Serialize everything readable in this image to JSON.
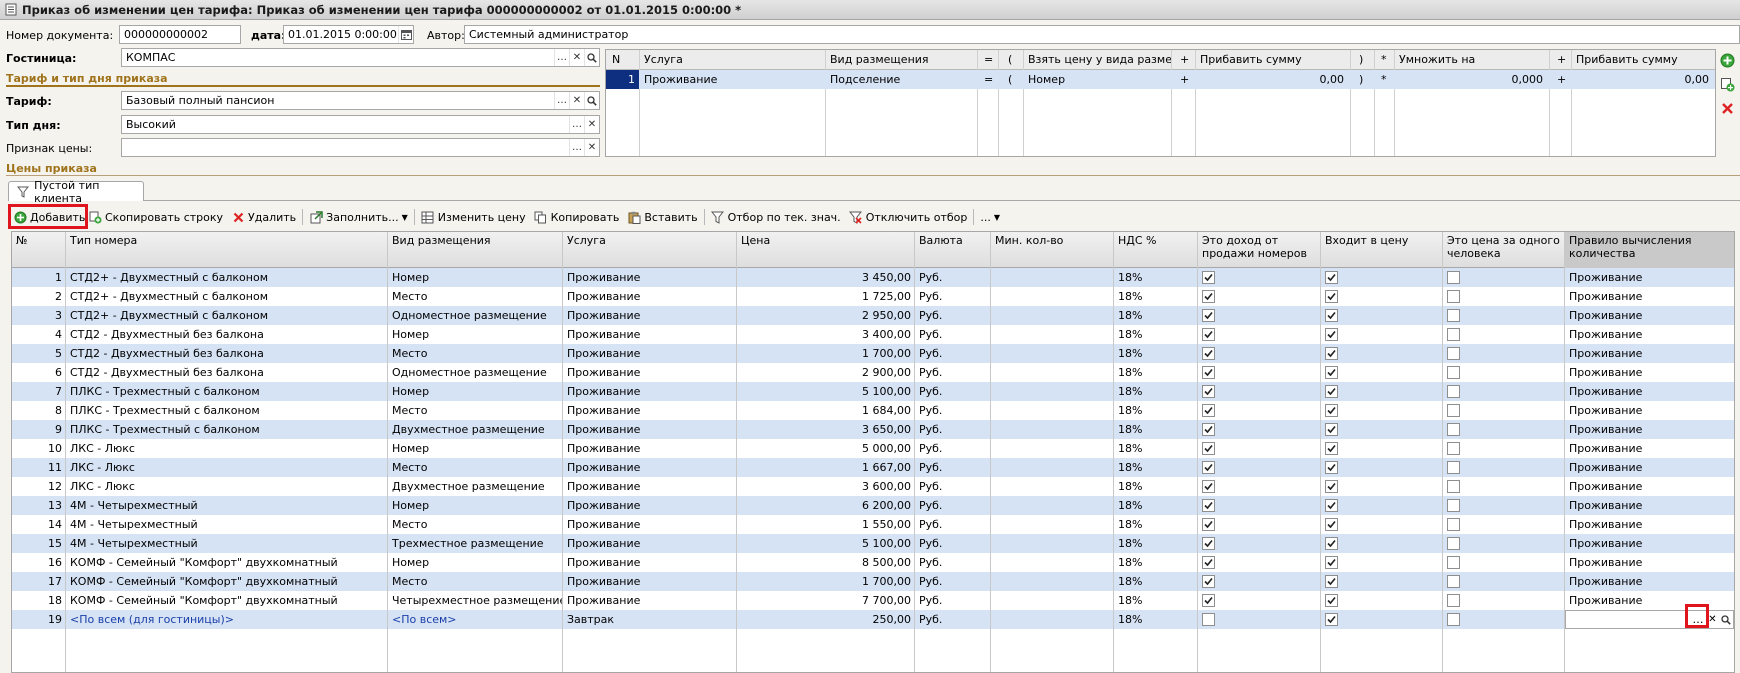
{
  "window": {
    "title": "Приказ об изменении цен тарифа: Приказ об изменении цен тарифа 000000000002 от 01.01.2015 0:00:00 *"
  },
  "header": {
    "doc_number_label": "Номер документа:",
    "doc_number": "000000000002",
    "date_label": "дата:",
    "date": "01.01.2015  0:00:00",
    "author_label": "Автор:",
    "author": "Системный администратор",
    "hotel_label": "Гостиница:",
    "hotel": "КОМПАС",
    "section_tariff": "Тариф и тип дня приказа",
    "tariff_label": "Тариф:",
    "tariff": "Базовый полный пансион",
    "daytype_label": "Тип дня:",
    "daytype": "Высокий",
    "price_sign_label": "Признак цены:",
    "price_sign": "",
    "section_prices": "Цены приказа"
  },
  "services_table": {
    "headers": [
      "N",
      "Услуга",
      "Вид размещения",
      "=",
      "(",
      "Взять цену у вида размещ.",
      "+",
      "Прибавить сумму",
      ")",
      "*",
      "Умножить на",
      "+",
      "Прибавить сумму"
    ],
    "rows": [
      [
        "1",
        "Проживание",
        "Подселение",
        "=",
        "(",
        "Номер",
        "+",
        "0,00",
        ")",
        "*",
        "0,000",
        "+",
        "0,00"
      ]
    ]
  },
  "tab": {
    "label": "Пустой тип клиента"
  },
  "toolbar": {
    "add": "Добавить",
    "copy_row": "Скопировать строку",
    "delete": "Удалить",
    "fill": "Заполнить...",
    "change_price": "Изменить цену",
    "copy": "Копировать",
    "paste": "Вставить",
    "filter": "Отбор по тек. знач.",
    "disable_filter": "Отключить отбор",
    "more": "..."
  },
  "grid": {
    "headers": [
      "№",
      "Тип номера",
      "Вид размещения",
      "Услуга",
      "Цена",
      "Валюта",
      "Мин. кол-во",
      "НДС %",
      "Это доход от продажи номеров",
      "Входит в цену",
      "Это цена за одного человека",
      "Правило вычисления количества"
    ],
    "rows": [
      {
        "n": "1",
        "type": "СТД2+ - Двухместный с балконом",
        "acc": "Номер",
        "svc": "Проживание",
        "price": "3 450,00",
        "cur": "Руб.",
        "min": "",
        "vat": "18%",
        "income": true,
        "incl": true,
        "perperson": false,
        "rule": "Проживание"
      },
      {
        "n": "2",
        "type": "СТД2+ - Двухместный с балконом",
        "acc": "Место",
        "svc": "Проживание",
        "price": "1 725,00",
        "cur": "Руб.",
        "min": "",
        "vat": "18%",
        "income": true,
        "incl": true,
        "perperson": false,
        "rule": "Проживание"
      },
      {
        "n": "3",
        "type": "СТД2+ - Двухместный с балконом",
        "acc": "Одноместное размещение",
        "svc": "Проживание",
        "price": "2 950,00",
        "cur": "Руб.",
        "min": "",
        "vat": "18%",
        "income": true,
        "incl": true,
        "perperson": false,
        "rule": "Проживание"
      },
      {
        "n": "4",
        "type": "СТД2 - Двухместный без балкона",
        "acc": "Номер",
        "svc": "Проживание",
        "price": "3 400,00",
        "cur": "Руб.",
        "min": "",
        "vat": "18%",
        "income": true,
        "incl": true,
        "perperson": false,
        "rule": "Проживание"
      },
      {
        "n": "5",
        "type": "СТД2 - Двухместный без балкона",
        "acc": "Место",
        "svc": "Проживание",
        "price": "1 700,00",
        "cur": "Руб.",
        "min": "",
        "vat": "18%",
        "income": true,
        "incl": true,
        "perperson": false,
        "rule": "Проживание"
      },
      {
        "n": "6",
        "type": "СТД2 - Двухместный без балкона",
        "acc": "Одноместное размещение",
        "svc": "Проживание",
        "price": "2 900,00",
        "cur": "Руб.",
        "min": "",
        "vat": "18%",
        "income": true,
        "incl": true,
        "perperson": false,
        "rule": "Проживание"
      },
      {
        "n": "7",
        "type": "ПЛКС - Трехместный с балконом",
        "acc": "Номер",
        "svc": "Проживание",
        "price": "5 100,00",
        "cur": "Руб.",
        "min": "",
        "vat": "18%",
        "income": true,
        "incl": true,
        "perperson": false,
        "rule": "Проживание"
      },
      {
        "n": "8",
        "type": "ПЛКС - Трехместный с балконом",
        "acc": "Место",
        "svc": "Проживание",
        "price": "1 684,00",
        "cur": "Руб.",
        "min": "",
        "vat": "18%",
        "income": true,
        "incl": true,
        "perperson": false,
        "rule": "Проживание"
      },
      {
        "n": "9",
        "type": "ПЛКС - Трехместный с балконом",
        "acc": "Двухместное размещение",
        "svc": "Проживание",
        "price": "3 650,00",
        "cur": "Руб.",
        "min": "",
        "vat": "18%",
        "income": true,
        "incl": true,
        "perperson": false,
        "rule": "Проживание"
      },
      {
        "n": "10",
        "type": "ЛКС - Люкс",
        "acc": "Номер",
        "svc": "Проживание",
        "price": "5 000,00",
        "cur": "Руб.",
        "min": "",
        "vat": "18%",
        "income": true,
        "incl": true,
        "perperson": false,
        "rule": "Проживание"
      },
      {
        "n": "11",
        "type": "ЛКС - Люкс",
        "acc": "Место",
        "svc": "Проживание",
        "price": "1 667,00",
        "cur": "Руб.",
        "min": "",
        "vat": "18%",
        "income": true,
        "incl": true,
        "perperson": false,
        "rule": "Проживание"
      },
      {
        "n": "12",
        "type": "ЛКС - Люкс",
        "acc": "Двухместное размещение",
        "svc": "Проживание",
        "price": "3 600,00",
        "cur": "Руб.",
        "min": "",
        "vat": "18%",
        "income": true,
        "incl": true,
        "perperson": false,
        "rule": "Проживание"
      },
      {
        "n": "13",
        "type": "4М - Четырехместный",
        "acc": "Номер",
        "svc": "Проживание",
        "price": "6 200,00",
        "cur": "Руб.",
        "min": "",
        "vat": "18%",
        "income": true,
        "incl": true,
        "perperson": false,
        "rule": "Проживание"
      },
      {
        "n": "14",
        "type": "4М - Четырехместный",
        "acc": "Место",
        "svc": "Проживание",
        "price": "1 550,00",
        "cur": "Руб.",
        "min": "",
        "vat": "18%",
        "income": true,
        "incl": true,
        "perperson": false,
        "rule": "Проживание"
      },
      {
        "n": "15",
        "type": "4М - Четырехместный",
        "acc": "Трехместное размещение",
        "svc": "Проживание",
        "price": "5 100,00",
        "cur": "Руб.",
        "min": "",
        "vat": "18%",
        "income": true,
        "incl": true,
        "perperson": false,
        "rule": "Проживание"
      },
      {
        "n": "16",
        "type": "КОМФ - Семейный \"Комфорт\" двухкомнатный",
        "acc": "Номер",
        "svc": "Проживание",
        "price": "8 500,00",
        "cur": "Руб.",
        "min": "",
        "vat": "18%",
        "income": true,
        "incl": true,
        "perperson": false,
        "rule": "Проживание"
      },
      {
        "n": "17",
        "type": "КОМФ - Семейный \"Комфорт\" двухкомнатный",
        "acc": "Место",
        "svc": "Проживание",
        "price": "1 700,00",
        "cur": "Руб.",
        "min": "",
        "vat": "18%",
        "income": true,
        "incl": true,
        "perperson": false,
        "rule": "Проживание"
      },
      {
        "n": "18",
        "type": "КОМФ - Семейный \"Комфорт\" двухкомнатный",
        "acc": "Четырехместное размещение",
        "svc": "Проживание",
        "price": "7 700,00",
        "cur": "Руб.",
        "min": "",
        "vat": "18%",
        "income": true,
        "incl": true,
        "perperson": false,
        "rule": "Проживание"
      },
      {
        "n": "19",
        "type": "<По всем (для гостиницы)>",
        "acc": "<По всем>",
        "svc": "Завтрак",
        "price": "250,00",
        "cur": "Руб.",
        "min": "",
        "vat": "18%",
        "income": false,
        "incl": true,
        "perperson": false,
        "rule": ""
      }
    ]
  },
  "colors": {
    "accent_section": "#a0741c",
    "row_alt": "#d6e3f5",
    "highlight": "#e0141c"
  }
}
